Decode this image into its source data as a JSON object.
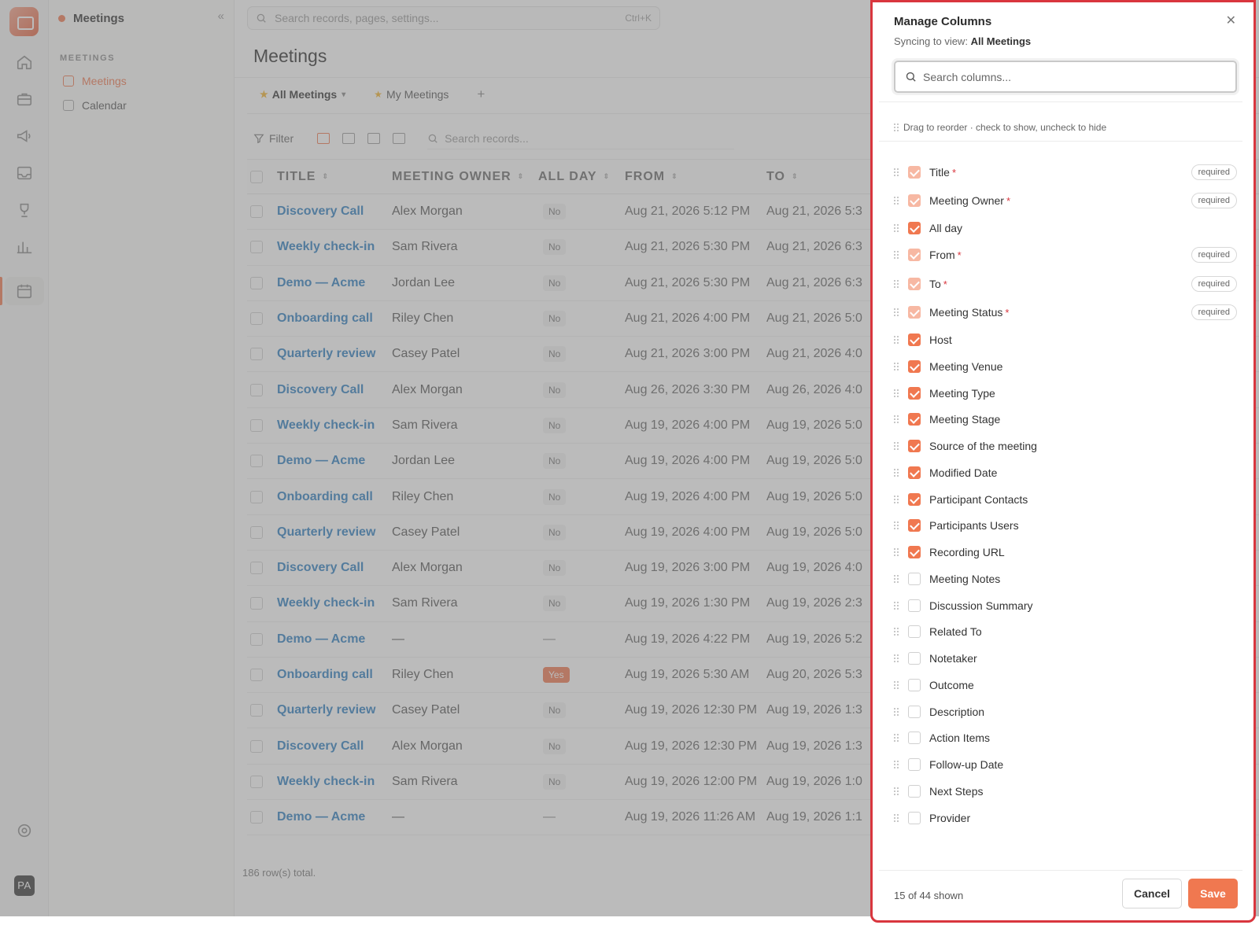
{
  "sidebar": {
    "title": "Meetings",
    "section": "MEETINGS",
    "items": [
      {
        "label": "Meetings",
        "active": true
      },
      {
        "label": "Calendar",
        "active": false
      }
    ]
  },
  "rail": {
    "avatar": "PA"
  },
  "global_search": {
    "placeholder": "Search records, pages, settings...",
    "shortcut": "Ctrl+K"
  },
  "main": {
    "title": "Meetings",
    "views": [
      {
        "label": "All Meetings",
        "active": true
      },
      {
        "label": "My Meetings",
        "active": false
      }
    ],
    "add_view": "+",
    "filter_label": "Filter",
    "record_search_placeholder": "Search records...",
    "columns": [
      "TITLE",
      "MEETING OWNER",
      "ALL DAY",
      "FROM",
      "TO"
    ],
    "rows": [
      {
        "title": "Discovery Call",
        "owner": "Alex Morgan",
        "allday": "No",
        "from": "Aug 21, 2026 5:12 PM",
        "to": "Aug 21, 2026 5:3"
      },
      {
        "title": "Weekly check-in",
        "owner": "Sam Rivera",
        "allday": "No",
        "from": "Aug 21, 2026 5:30 PM",
        "to": "Aug 21, 2026 6:3"
      },
      {
        "title": "Demo — Acme",
        "owner": "Jordan Lee",
        "allday": "No",
        "from": "Aug 21, 2026 5:30 PM",
        "to": "Aug 21, 2026 6:3"
      },
      {
        "title": "Onboarding call",
        "owner": "Riley Chen",
        "allday": "No",
        "from": "Aug 21, 2026 4:00 PM",
        "to": "Aug 21, 2026 5:0"
      },
      {
        "title": "Quarterly review",
        "owner": "Casey Patel",
        "allday": "No",
        "from": "Aug 21, 2026 3:00 PM",
        "to": "Aug 21, 2026 4:0"
      },
      {
        "title": "Discovery Call",
        "owner": "Alex Morgan",
        "allday": "No",
        "from": "Aug 26, 2026 3:30 PM",
        "to": "Aug 26, 2026 4:0"
      },
      {
        "title": "Weekly check-in",
        "owner": "Sam Rivera",
        "allday": "No",
        "from": "Aug 19, 2026 4:00 PM",
        "to": "Aug 19, 2026 5:0"
      },
      {
        "title": "Demo — Acme",
        "owner": "Jordan Lee",
        "allday": "No",
        "from": "Aug 19, 2026 4:00 PM",
        "to": "Aug 19, 2026 5:0"
      },
      {
        "title": "Onboarding call",
        "owner": "Riley Chen",
        "allday": "No",
        "from": "Aug 19, 2026 4:00 PM",
        "to": "Aug 19, 2026 5:0"
      },
      {
        "title": "Quarterly review",
        "owner": "Casey Patel",
        "allday": "No",
        "from": "Aug 19, 2026 4:00 PM",
        "to": "Aug 19, 2026 5:0"
      },
      {
        "title": "Discovery Call",
        "owner": "Alex Morgan",
        "allday": "No",
        "from": "Aug 19, 2026 3:00 PM",
        "to": "Aug 19, 2026 4:0"
      },
      {
        "title": "Weekly check-in",
        "owner": "Sam Rivera",
        "allday": "No",
        "from": "Aug 19, 2026 1:30 PM",
        "to": "Aug 19, 2026 2:3"
      },
      {
        "title": "Demo — Acme",
        "owner": "—",
        "allday": "—",
        "from": "Aug 19, 2026 4:22 PM",
        "to": "Aug 19, 2026 5:2"
      },
      {
        "title": "Onboarding call",
        "owner": "Riley Chen",
        "allday": "Yes",
        "from": "Aug 19, 2026 5:30 AM",
        "to": "Aug 20, 2026 5:3"
      },
      {
        "title": "Quarterly review",
        "owner": "Casey Patel",
        "allday": "No",
        "from": "Aug 19, 2026 12:30 PM",
        "to": "Aug 19, 2026 1:3"
      },
      {
        "title": "Discovery Call",
        "owner": "Alex Morgan",
        "allday": "No",
        "from": "Aug 19, 2026 12:30 PM",
        "to": "Aug 19, 2026 1:3"
      },
      {
        "title": "Weekly check-in",
        "owner": "Sam Rivera",
        "allday": "No",
        "from": "Aug 19, 2026 12:00 PM",
        "to": "Aug 19, 2026 1:0"
      },
      {
        "title": "Demo — Acme",
        "owner": "—",
        "allday": "—",
        "from": "Aug 19, 2026 11:26 AM",
        "to": "Aug 19, 2026 1:1"
      }
    ],
    "rows_total": "186 row(s) total."
  },
  "drawer": {
    "title": "Manage Columns",
    "sync_prefix": "Syncing to view:",
    "sync_view": "All Meetings",
    "search_placeholder": "Search columns...",
    "hint": "Drag to reorder · check to show, uncheck to hide",
    "required_label": "required",
    "columns": [
      {
        "label": "Title",
        "checked": true,
        "required": true
      },
      {
        "label": "Meeting Owner",
        "checked": true,
        "required": true
      },
      {
        "label": "All day",
        "checked": true,
        "required": false
      },
      {
        "label": "From",
        "checked": true,
        "required": true
      },
      {
        "label": "To",
        "checked": true,
        "required": true
      },
      {
        "label": "Meeting Status",
        "checked": true,
        "required": true
      },
      {
        "label": "Host",
        "checked": true,
        "required": false
      },
      {
        "label": "Meeting Venue",
        "checked": true,
        "required": false
      },
      {
        "label": "Meeting Type",
        "checked": true,
        "required": false
      },
      {
        "label": "Meeting Stage",
        "checked": true,
        "required": false
      },
      {
        "label": "Source of the meeting",
        "checked": true,
        "required": false
      },
      {
        "label": "Modified Date",
        "checked": true,
        "required": false
      },
      {
        "label": "Participant Contacts",
        "checked": true,
        "required": false
      },
      {
        "label": "Participants Users",
        "checked": true,
        "required": false
      },
      {
        "label": "Recording URL",
        "checked": true,
        "required": false
      },
      {
        "label": "Meeting Notes",
        "checked": false,
        "required": false
      },
      {
        "label": "Discussion Summary",
        "checked": false,
        "required": false
      },
      {
        "label": "Related To",
        "checked": false,
        "required": false
      },
      {
        "label": "Notetaker",
        "checked": false,
        "required": false
      },
      {
        "label": "Outcome",
        "checked": false,
        "required": false
      },
      {
        "label": "Description",
        "checked": false,
        "required": false
      },
      {
        "label": "Action Items",
        "checked": false,
        "required": false
      },
      {
        "label": "Follow-up Date",
        "checked": false,
        "required": false
      },
      {
        "label": "Next Steps",
        "checked": false,
        "required": false
      },
      {
        "label": "Provider",
        "checked": false,
        "required": false
      }
    ],
    "count_text": "15 of 44 shown",
    "cancel_label": "Cancel",
    "save_label": "Save"
  },
  "colors": {
    "accent": "#f07850",
    "link": "#2f7fc1",
    "highlight_border": "#d9363e"
  },
  "icons": [
    "home-icon",
    "briefcase-icon",
    "megaphone-icon",
    "inbox-icon",
    "trophy-icon",
    "chart-icon",
    "calendar-icon",
    "gear-icon",
    "search-icon",
    "close-icon",
    "drag-handle-icon",
    "filter-icon"
  ]
}
